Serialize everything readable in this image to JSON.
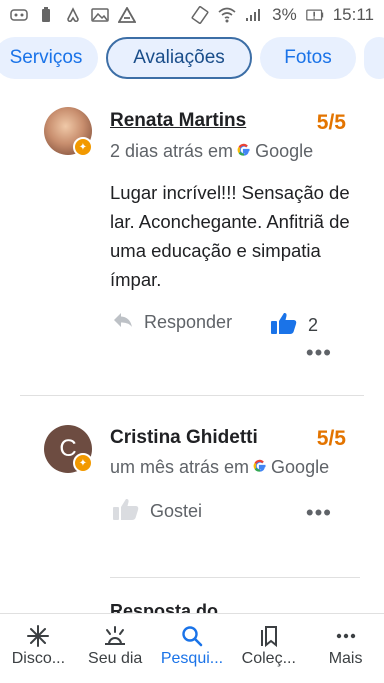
{
  "status_bar": {
    "battery_text": "3%",
    "time": "15:11"
  },
  "tabs": [
    {
      "label": "Serviços"
    },
    {
      "label": "Avaliações"
    },
    {
      "label": "Fotos"
    }
  ],
  "reviews": [
    {
      "name": "Renata Martins",
      "score": "5/5",
      "date": "2 dias atrás em",
      "source": "Google",
      "text": "Lugar incrível!!! Sensação de lar. Aconchegante. Anfitriã de uma educação e simpatia ímpar.",
      "reply_label": "Responder",
      "like_count": "2"
    },
    {
      "name": "Cristina Ghidetti",
      "avatar_letter": "C",
      "score": "5/5",
      "date": "um mês atrás em",
      "source": "Google",
      "like_label": "Gostei"
    }
  ],
  "partial_text": "Resposta do",
  "bottom_nav": [
    {
      "label": "Disco...",
      "icon": "asterisk-icon"
    },
    {
      "label": "Seu dia",
      "icon": "sunrise-icon"
    },
    {
      "label": "Pesqui...",
      "icon": "search-icon"
    },
    {
      "label": "Coleç...",
      "icon": "bookmarks-icon"
    },
    {
      "label": "Mais",
      "icon": "more-dots-icon"
    }
  ],
  "colors": {
    "accent": "#1a73e8",
    "score": "#e37400"
  }
}
